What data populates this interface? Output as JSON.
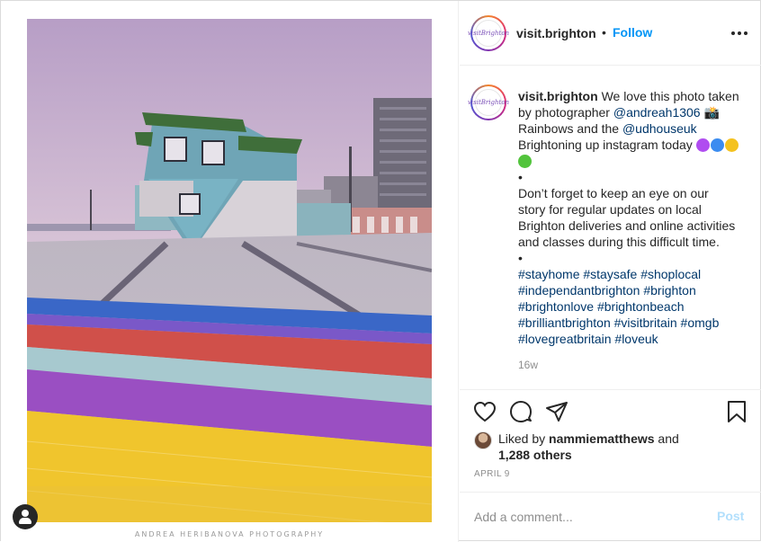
{
  "post": {
    "photo_alt": "photo",
    "photo_credit": "ANDREA HERIBANOVA PHOTOGRAPHY",
    "user_tag_icon": "person-icon"
  },
  "header": {
    "avatar_text": "visitBrighton",
    "username": "visit.brighton",
    "separator": "•",
    "follow_label": "Follow",
    "more_icon": "more-options-icon"
  },
  "caption": {
    "username": "visit.brighton",
    "l1_text": "We love this photo taken",
    "l2_text": "by photographer ",
    "l2_mention": "@andreah1306",
    "l2_emoji": "📸",
    "l3_text": "Rainbows and the ",
    "l3_mention": "@udhouseuk",
    "l4_text": "Brightoning up instagram today",
    "emoji_hearts": [
      "purple-heart",
      "blue-heart",
      "yellow-heart",
      "green-heart"
    ],
    "bullet1": "•",
    "l6": "Don’t forget to keep an eye on our",
    "l7": "story for regular updates on local",
    "l8": "Brighton deliveries and online activities",
    "l9": "and classes during this difficult time.",
    "bullet2": "•",
    "hashtags": [
      [
        "#stayhome",
        "#staysafe",
        "#shoplocal"
      ],
      [
        "#independantbrighton",
        "#brighton"
      ],
      [
        "#brightonlove",
        "#brightonbeach"
      ],
      [
        "#brilliantbrighton",
        "#visitbritain",
        "#omgb"
      ],
      [
        "#lovegreatbritain",
        "#loveuk"
      ]
    ],
    "time_ago": "16w"
  },
  "actions": {
    "like_icon": "heart-icon",
    "comment_icon": "comment-icon",
    "share_icon": "share-icon",
    "save_icon": "bookmark-icon"
  },
  "likes": {
    "prefix": "Liked by ",
    "user": "nammiematthews",
    "and": " and",
    "count": "1,288 others"
  },
  "date": "APRIL 9",
  "comment_box": {
    "placeholder": "Add a comment...",
    "post_label": "Post"
  },
  "colors": {
    "link": "#00376b",
    "follow": "#0095f6",
    "post_disabled": "#b2dffc",
    "muted": "#8e8e8e"
  }
}
